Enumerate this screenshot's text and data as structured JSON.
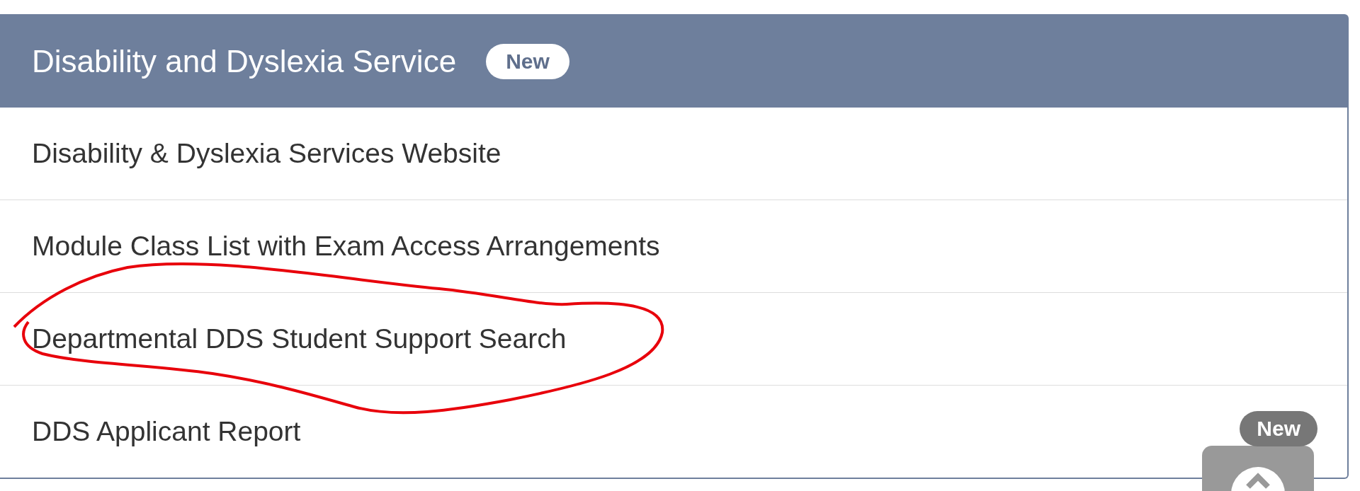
{
  "panel": {
    "title": "Disability and Dyslexia Service",
    "badge": "New",
    "links": [
      {
        "label": "Disability & Dyslexia Services Website"
      },
      {
        "label": "Module Class List with Exam Access Arrangements"
      },
      {
        "label": "Departmental DDS Student Support Search",
        "annotated": true
      },
      {
        "label": "DDS Applicant Report",
        "badge": "New"
      }
    ]
  }
}
